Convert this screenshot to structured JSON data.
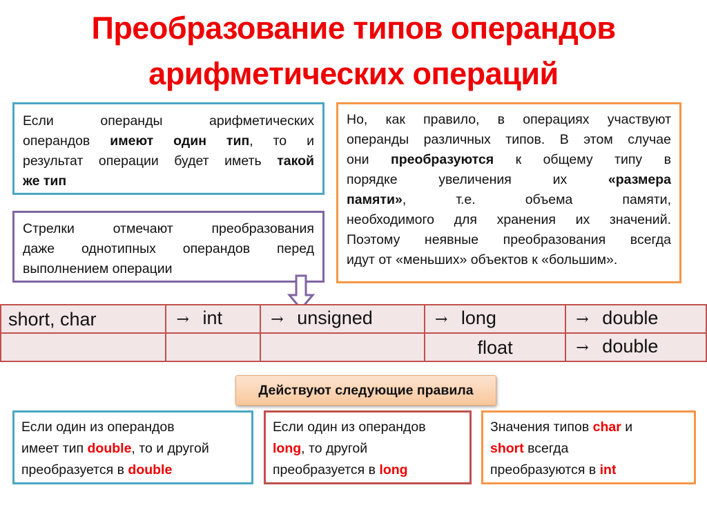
{
  "title": {
    "line1": "Преобразование типов операндов",
    "line2": "арифметических операций"
  },
  "box_same_type": {
    "l1": "Если операнды арифметических",
    "l2a": "операндов ",
    "l2b": "имеют один тип",
    "l2c": ", то и",
    "l3a": "результат операции будет иметь ",
    "l3b": "такой",
    "l4": "же тип"
  },
  "box_arrows": {
    "l1": "Стрелки отмечают преобразования",
    "l2": "даже однотипных операндов перед",
    "l3": "выполнением операции"
  },
  "box_different_types": {
    "l1": "Но, как правило, в операциях участвуют",
    "l2": "операнды различных типов. В этом случае",
    "l3a": "они ",
    "l3b": "преобразуются",
    "l3c": " к общему типу в",
    "l4a": "порядке увеличения их ",
    "l4b": "«размера",
    "l5a": "памяти»",
    "l5b": ", т.е. объема памяти,",
    "l6": "необходимого для хранения их значений.",
    "l7": "Поэтому неявные преобразования всегда",
    "l8": "идут от «меньших» объектов к «большим»."
  },
  "conversion_table": {
    "arrow_symbol": "→",
    "rows": [
      [
        "short, char",
        "int",
        "unsigned",
        "long",
        "double"
      ],
      [
        "",
        "",
        "",
        "float",
        "double"
      ]
    ]
  },
  "rules_header": "Действуют следующие правила",
  "rules": [
    {
      "a": "Если один из операндов",
      "b": "имеет тип ",
      "c": "double",
      "d": ", то и другой",
      "e": "преобразуется в ",
      "f": "double"
    },
    {
      "a": "Если один из операндов",
      "c": "long",
      "d": ", то другой",
      "e": "преобразуется в ",
      "f": "long"
    },
    {
      "a": "Значения типов ",
      "a2": "char",
      "a3": " и",
      "c": "short",
      "d": " всегда",
      "e": "преобразуются в ",
      "f": "int"
    }
  ],
  "colors": {
    "title": "#ee0000",
    "blue_border": "#4aa7c2",
    "purple_border": "#8064a2",
    "orange_border": "#f79646",
    "table_border": "#c0504d",
    "table_fill": "#f2e6e6",
    "highlight": "#ee0000"
  }
}
